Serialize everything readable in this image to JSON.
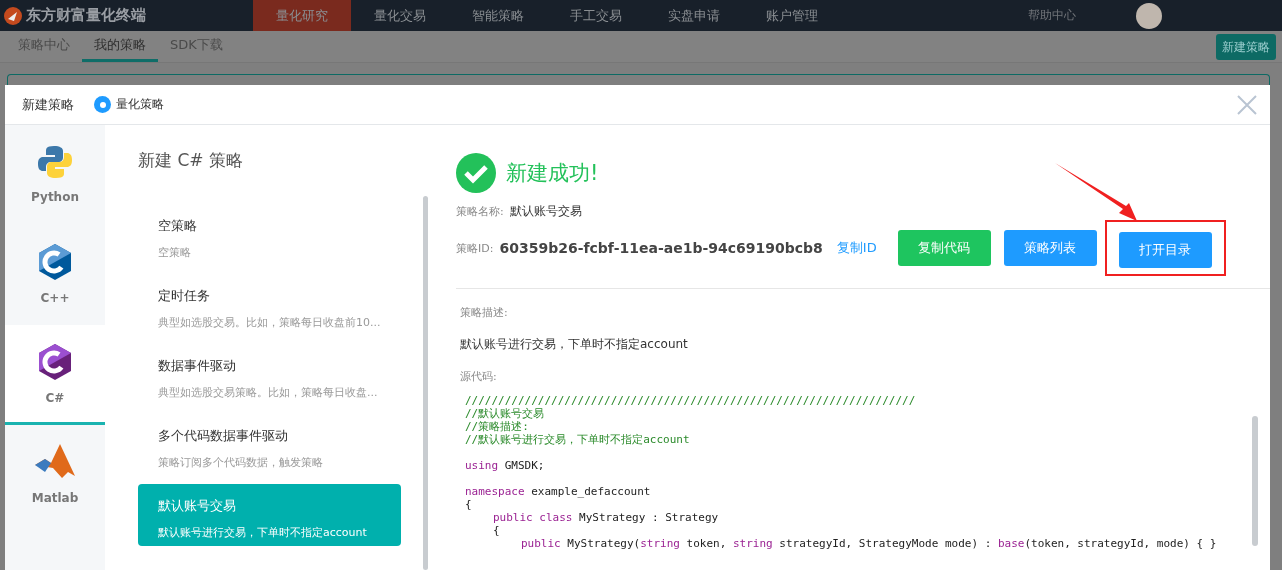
{
  "app": {
    "title": "东方财富量化终端",
    "nav": [
      {
        "label": "量化研究",
        "selected": true
      },
      {
        "label": "量化交易",
        "selected": false
      },
      {
        "label": "智能策略",
        "selected": false
      },
      {
        "label": "手工交易",
        "selected": false
      },
      {
        "label": "实盘申请",
        "selected": false
      },
      {
        "label": "账户管理",
        "selected": false
      }
    ],
    "help": "帮助中心"
  },
  "subtabs": [
    {
      "label": "策略中心",
      "selected": false
    },
    {
      "label": "我的策略",
      "selected": true
    },
    {
      "label": "SDK下载",
      "selected": false
    }
  ],
  "new_button": "新建策略",
  "dialog": {
    "title": "新建策略",
    "radio": {
      "label": "量化策略",
      "selected": true
    },
    "languages": [
      {
        "label": "Python",
        "kind": "python",
        "selected": false
      },
      {
        "label": "C++",
        "kind": "cpp",
        "selected": false
      },
      {
        "label": "C#",
        "kind": "csharp",
        "selected": true
      },
      {
        "label": "Matlab",
        "kind": "matlab",
        "selected": false
      }
    ],
    "panel_title": "新建 C# 策略",
    "templates": [
      {
        "title": "空策略",
        "desc": "空策略",
        "selected": false
      },
      {
        "title": "定时任务",
        "desc": "典型如选股交易。比如，策略每日收盘前10...",
        "selected": false
      },
      {
        "title": "数据事件驱动",
        "desc": "典型如选股交易策略。比如，策略每日收盘...",
        "selected": false
      },
      {
        "title": "多个代码数据事件驱动",
        "desc": "策略订阅多个代码数据，触发策略",
        "selected": false
      },
      {
        "title": "默认账号交易",
        "desc": "默认账号进行交易，下单时不指定account",
        "selected": true
      }
    ],
    "success": "新建成功!",
    "name_label": "策略名称:",
    "name_value": "默认账号交易",
    "id_label": "策略ID:",
    "id_value": "60359b26-fcbf-11ea-ae1b-94c69190bcb8",
    "copy_id": "复制ID",
    "buttons": [
      {
        "label": "复制代码",
        "kind": "green",
        "highlighted": false
      },
      {
        "label": "策略列表",
        "kind": "blue",
        "highlighted": false
      },
      {
        "label": "打开目录",
        "kind": "blue",
        "highlighted": true
      }
    ],
    "desc_label": "策略描述:",
    "desc_value": "默认账号进行交易，下单时不指定account",
    "code_label": "源代码:",
    "code": [
      [
        {
          "kind": "comment",
          "text": "////////////////////////////////////////////////////////////////////"
        }
      ],
      [
        {
          "kind": "comment",
          "text": "//默认账号交易"
        }
      ],
      [
        {
          "kind": "comment",
          "text": "//策略描述:"
        }
      ],
      [
        {
          "kind": "comment",
          "text": "//默认账号进行交易，下单时不指定account"
        }
      ],
      [
        {
          "kind": "blank"
        }
      ],
      [
        {
          "kind": "keyword",
          "text": "using"
        },
        {
          "kind": "plain",
          "text": " GMSDK;"
        }
      ],
      [
        {
          "kind": "blank"
        }
      ],
      [
        {
          "kind": "keyword",
          "text": "namespace"
        },
        {
          "kind": "plain",
          "text": " example_defaccount"
        }
      ],
      [
        {
          "kind": "plain",
          "text": "{"
        }
      ],
      [
        {
          "kind": "indent"
        },
        {
          "kind": "keyword",
          "text": "public class"
        },
        {
          "kind": "plain",
          "text": " MyStrategy : Strategy"
        }
      ],
      [
        {
          "kind": "indent"
        },
        {
          "kind": "plain",
          "text": "{"
        }
      ],
      [
        {
          "kind": "indent"
        },
        {
          "kind": "indent"
        },
        {
          "kind": "keyword",
          "text": "public"
        },
        {
          "kind": "plain",
          "text": " MyStrategy("
        },
        {
          "kind": "keyword",
          "text": "string"
        },
        {
          "kind": "plain",
          "text": " token, "
        },
        {
          "kind": "keyword",
          "text": "string"
        },
        {
          "kind": "plain",
          "text": " strategyId, StrategyMode mode) : "
        },
        {
          "kind": "keyword",
          "text": "base"
        },
        {
          "kind": "plain",
          "text": "(token, strategyId, mode) { }"
        }
      ]
    ]
  }
}
